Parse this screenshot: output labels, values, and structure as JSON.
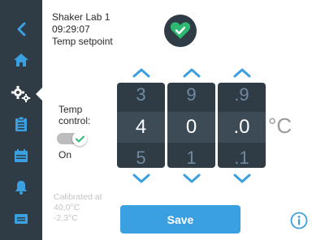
{
  "header": {
    "device": "Shaker Lab 1",
    "time": "09:29:07",
    "screen": "Temp setpoint"
  },
  "status_icon": "heart-check-icon",
  "sidebar": {
    "items": [
      {
        "icon": "back-arrow-icon"
      },
      {
        "icon": "home-icon"
      },
      {
        "icon": "settings-icon",
        "active": true
      },
      {
        "icon": "clipboard-icon"
      },
      {
        "icon": "calendar-icon"
      },
      {
        "icon": "bell-icon"
      },
      {
        "icon": "message-icon"
      }
    ]
  },
  "temp_control": {
    "label": "Temp control:",
    "state": "On",
    "enabled": true
  },
  "calibration": {
    "line1": "Calibrated at",
    "line2": "40,0°C",
    "line3": "-2,3°C"
  },
  "setpoint": {
    "drums": [
      {
        "prev": "3",
        "current": "4",
        "next": "5"
      },
      {
        "prev": "9",
        "current": "0",
        "next": "1"
      },
      {
        "prev": ".9",
        "current": ".0",
        "next": ".1"
      }
    ],
    "unit": "°C"
  },
  "actions": {
    "save_label": "Save"
  },
  "colors": {
    "sidebar": "#2f3b45",
    "accent": "#3aa0e0",
    "status_green": "#2eb872"
  }
}
